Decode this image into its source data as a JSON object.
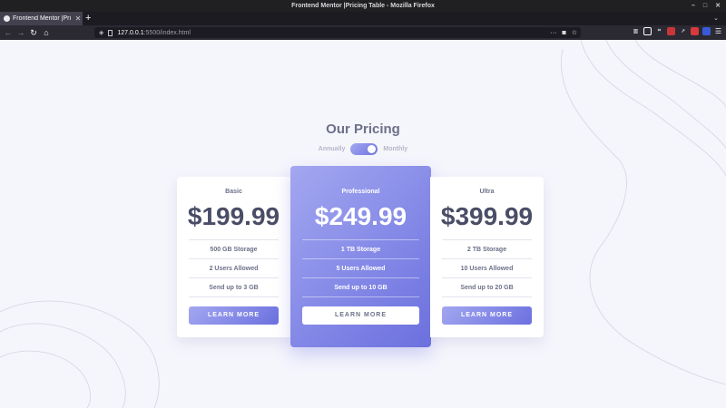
{
  "window": {
    "title": "Frontend Mentor |Pricing Table - Mozilla Firefox",
    "controls": [
      "–",
      "□",
      "✕"
    ]
  },
  "browser": {
    "tab_title": "Frontend Mentor |Pricing Table",
    "tab_close": "✕",
    "new_tab": "+",
    "tab_list": "⌄",
    "back": "←",
    "forward": "→",
    "reload": "↻",
    "home": "⌂",
    "url_host": "127.0.0.1",
    "url_path": ":5500/index.html",
    "page_actions": "···",
    "pocket": "◙",
    "bookmark": "☆",
    "menu": "☰"
  },
  "page": {
    "heading": "Our Pricing",
    "toggle": {
      "left_label": "Annually",
      "right_label": "Monthly",
      "position": "monthly"
    },
    "plans": [
      {
        "name": "Basic",
        "price": "$199.99",
        "features": [
          "500 GB Storage",
          "2 Users Allowed",
          "Send up to 3 GB"
        ],
        "button": "LEARN MORE"
      },
      {
        "name": "Professional",
        "price": "$249.99",
        "features": [
          "1 TB Storage",
          "5 Users Allowed",
          "Send up to 10 GB"
        ],
        "button": "LEARN MORE"
      },
      {
        "name": "Ultra",
        "price": "$399.99",
        "features": [
          "2 TB Storage",
          "10 Users Allowed",
          "Send up to 20 GB"
        ],
        "button": "LEARN MORE"
      }
    ]
  },
  "colors": {
    "accent_light": "#a3a7f0",
    "accent_dark": "#6b70df",
    "text": "#6d7089",
    "price": "#4a4d66",
    "background": "#f5f5fc"
  }
}
